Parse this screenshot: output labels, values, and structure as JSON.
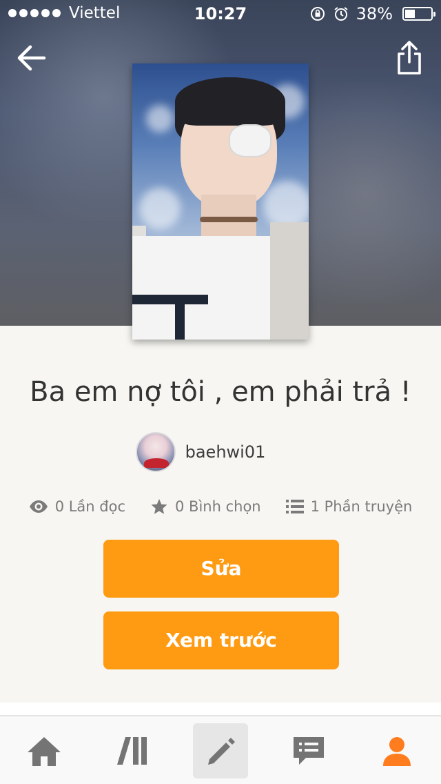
{
  "status_bar": {
    "carrier": "Viettel",
    "time": "10:27",
    "battery": "38%"
  },
  "story": {
    "title": "Ba em nợ tôi , em phải trả !",
    "author": "baehwi01",
    "stats": {
      "reads": "0 Lần đọc",
      "votes": "0 Bình chọn",
      "parts": "1 Phần truyện"
    }
  },
  "actions": {
    "edit_label": "Sửa",
    "preview_label": "Xem trước"
  },
  "tabbar": {
    "items": [
      {
        "icon": "home-icon",
        "active": false
      },
      {
        "icon": "library-icon",
        "active": false
      },
      {
        "icon": "pencil-icon",
        "active": true
      },
      {
        "icon": "messages-icon",
        "active": false
      },
      {
        "icon": "profile-icon",
        "active": false
      }
    ]
  },
  "colors": {
    "accent": "#ff9b12",
    "profile_active": "#ff7c1f",
    "tab_icon": "#747474"
  }
}
